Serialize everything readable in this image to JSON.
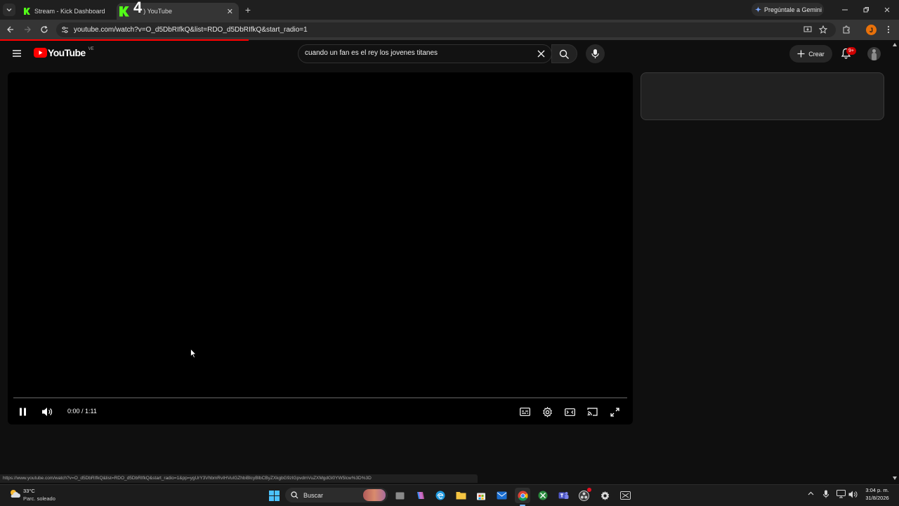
{
  "browser": {
    "tabs": [
      {
        "title": "Stream - Kick Dashboard",
        "active": false
      },
      {
        "title": "4",
        "active": true,
        "title_suffix": ") YouTube"
      }
    ],
    "gemini_label": "Pregúntale a Gemini",
    "url": "youtube.com/watch?v=O_d5DbRIfkQ&list=RDO_d5DbRIfkQ&start_radio=1",
    "profile_initial": "J",
    "status_url": "https://www.youtube.com/watch?v=O_d5DbRIfkQ&list=RDO_d5DbRIfkQ&start_radio=1&pp=ygUrY3VhbmRvIHVuIGZhbiBlcyBlbCByZXkgbG9zIGpvdmVuZXMgdGl0YW5lcw%3D%3D"
  },
  "youtube": {
    "logo_text": "YouTube",
    "region": "VE",
    "search_query": "cuando un fan es el rey los jovenes titanes",
    "create_label": "Crear",
    "notification_badge": "9+"
  },
  "player": {
    "time": "0:00 / 1:11",
    "progress_fraction": 0.0
  },
  "taskbar": {
    "temperature": "33°C",
    "weather": "Parc. soleado",
    "search_label": "Buscar",
    "clock_time": "3:04 p. m.",
    "clock_date": "31/8/2026"
  },
  "colors": {
    "youtube_red": "#ff0000",
    "kick_green": "#53fc18",
    "profile_orange": "#e8710a"
  }
}
